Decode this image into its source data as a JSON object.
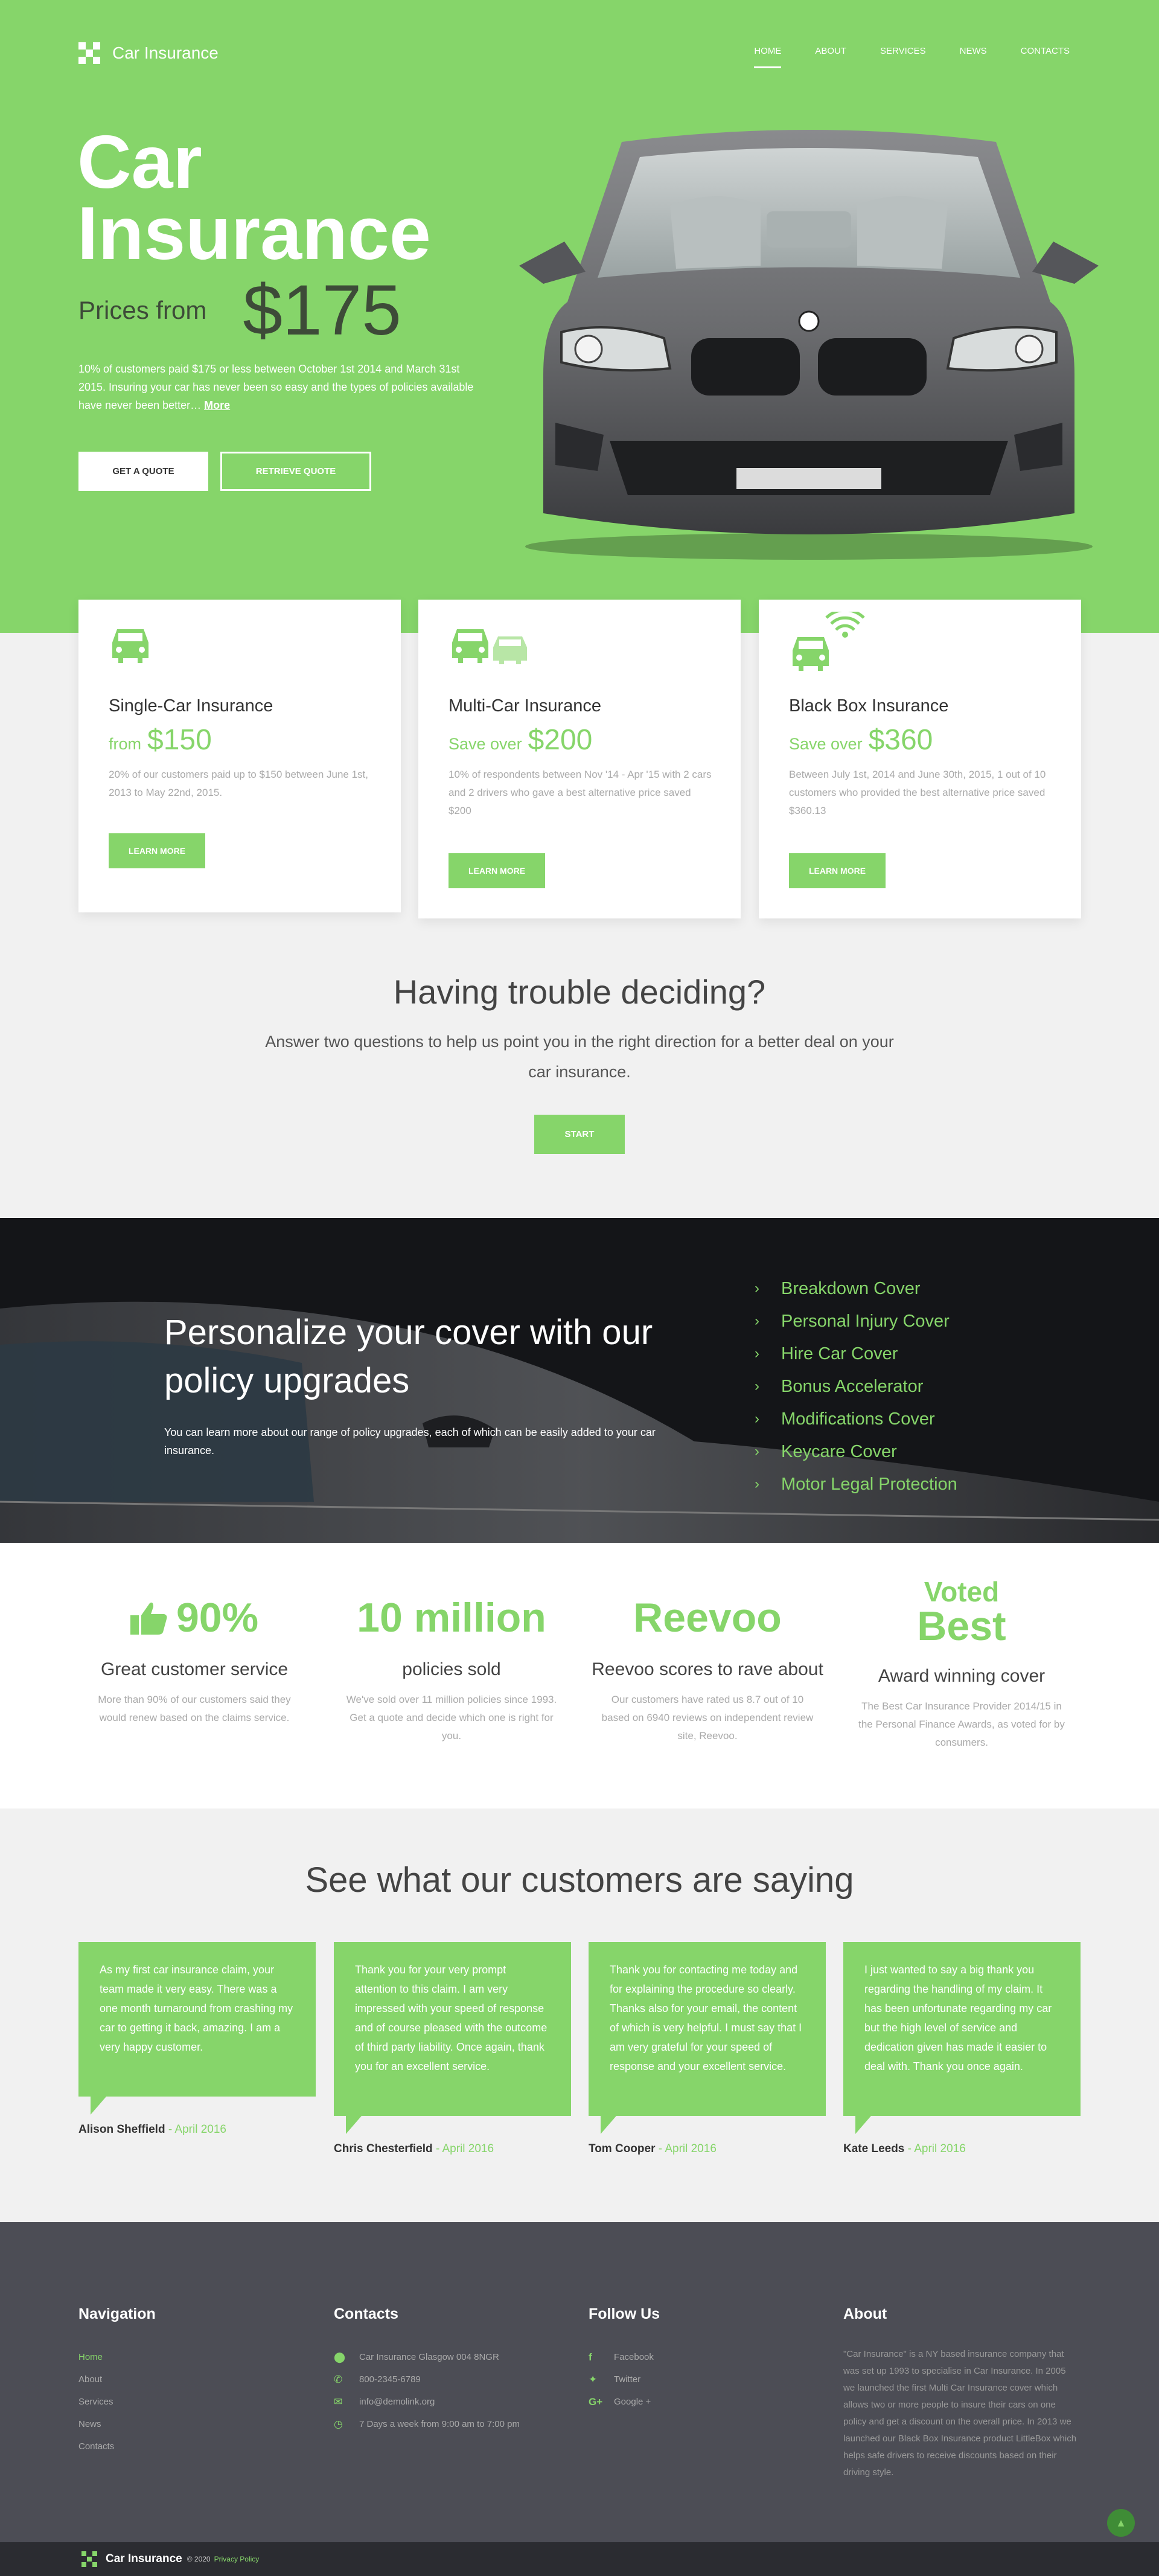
{
  "brand": {
    "name": "Car Insurance"
  },
  "nav": [
    {
      "label": "Home",
      "active": true
    },
    {
      "label": "About"
    },
    {
      "label": "Services"
    },
    {
      "label": "News"
    },
    {
      "label": "Contacts"
    }
  ],
  "hero": {
    "title_line1": "Car",
    "title_line2": "Insurance",
    "price_label": "Prices from",
    "price_value": "$175",
    "text": "10% of customers paid $175 or less between October 1st 2014 and March 31st 2015. Insuring your car has never been so easy and the types of policies available have never been better…",
    "more_link": "More",
    "get_quote": "Get a quote",
    "retrieve_quote": "Retrieve quote"
  },
  "cards": [
    {
      "title": "Single-Car Insurance",
      "price_label": "from",
      "price": "$150",
      "text": "20% of our customers paid up to $150 between June 1st, 2013 to May 22nd, 2015.",
      "button": "Learn more"
    },
    {
      "title": "Multi-Car Insurance",
      "price_label": "Save over",
      "price": "$200",
      "text": "10% of respondents between Nov '14 - Apr '15 with 2 cars and 2 drivers who gave a best alternative price saved $200",
      "button": "Learn more"
    },
    {
      "title": "Black Box Insurance",
      "price_label": "Save over",
      "price": "$360",
      "text": "Between July 1st, 2014 and June 30th, 2015, 1 out of 10 customers who provided the best alternative price saved $360.13",
      "button": "Learn more"
    }
  ],
  "decide": {
    "title": "Having trouble deciding?",
    "text": "Answer two questions to help us point you in the right direction for a better deal on your car insurance.",
    "button": "Start"
  },
  "upgrades": {
    "title": "Personalize your cover with our policy upgrades",
    "text": "You can learn more about our range of policy upgrades, each of which can be easily added to your car insurance.",
    "items": [
      "Breakdown Cover",
      "Personal Injury Cover",
      "Hire Car Cover",
      "Bonus Accelerator",
      "Modifications Cover",
      "Keycare Cover",
      "Motor Legal Protection"
    ]
  },
  "stats": [
    {
      "big": "90%",
      "sub": "Great customer service",
      "text": "More than 90% of our customers said they would renew based on the claims service."
    },
    {
      "big": "10 million",
      "sub": "policies sold",
      "text": "We've sold over 11 million policies since 1993. Get a quote and decide which one is right for you."
    },
    {
      "big": "Reevoo",
      "sub": "Reevoo scores to rave about",
      "text": "Our customers have rated us 8.7 out of 10 based on 6940 reviews on independent review site, Reevoo."
    },
    {
      "big_small": "Voted",
      "big": "Best",
      "sub": "Award winning cover",
      "text": "The Best Car Insurance Provider 2014/15 in the Personal Finance Awards, as voted for by consumers."
    }
  ],
  "testimonials": {
    "title": "See what our customers are saying",
    "items": [
      {
        "text": "As my first car insurance claim, your team made it very easy. There was a one month turnaround from crashing my car to getting it back, amazing. I am a very happy customer.",
        "name": "Alison Sheffield",
        "date": "April 2016"
      },
      {
        "text": "Thank you for your very prompt attention to this claim. I am very impressed with your speed of response and of course pleased with the outcome of third party liability. Once again, thank you for an excellent service.",
        "name": "Chris Chesterfield",
        "date": "April 2016"
      },
      {
        "text": "Thank you for contacting me today and for explaining the procedure so clearly. Thanks also for your email, the content of which is very helpful. I must say that I am very grateful for your speed of response and your excellent service.",
        "name": "Tom Cooper",
        "date": "April 2016"
      },
      {
        "text": "I just wanted to say a big thank you regarding the handling of my claim. It has been unfortunate regarding my car but the high level of service and dedication given has made it easier to deal with. Thank you once again.",
        "name": "Kate Leeds",
        "date": "April 2016"
      }
    ]
  },
  "footer": {
    "nav_title": "Navigation",
    "nav": [
      "Home",
      "About",
      "Services",
      "News",
      "Contacts"
    ],
    "contacts_title": "Contacts",
    "contacts": [
      {
        "icon": "map-pin-icon",
        "text": "Car Insurance Glasgow 004 8NGR"
      },
      {
        "icon": "phone-icon",
        "text": "800-2345-6789"
      },
      {
        "icon": "mail-icon",
        "text": "info@demolink.org"
      },
      {
        "icon": "clock-icon",
        "text": "7 Days a week from 9:00 am to 7:00 pm"
      }
    ],
    "follow_title": "Follow Us",
    "social": [
      {
        "icon": "facebook-icon",
        "text": "Facebook"
      },
      {
        "icon": "twitter-icon",
        "text": "Twitter"
      },
      {
        "icon": "google-plus-icon",
        "text": "Google +"
      }
    ],
    "about_title": "About",
    "about_text": "\"Car Insurance\" is a NY based insurance company that was set up 1993 to specialise in Car Insurance. In 2005 we launched the first Multi Car Insurance cover which allows two or more people to insure their cars on one policy and get a discount on the overall price. In 2013 we launched our Black Box Insurance product LittleBox which helps safe drivers to receive discounts based on their driving style.",
    "copyright": "© 2020",
    "privacy": "Privacy Policy"
  },
  "colors": {
    "accent": "#86d56a",
    "dark": "#141518",
    "footer": "#4c4d55"
  }
}
